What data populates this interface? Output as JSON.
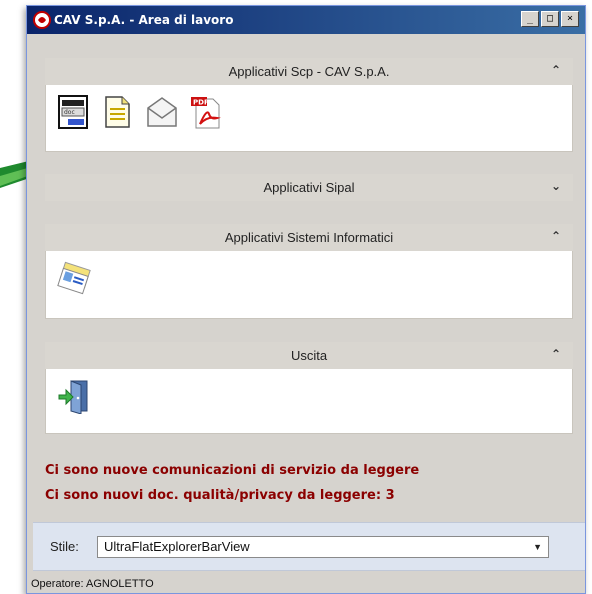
{
  "window": {
    "title": "CAV S.p.A. - Area di lavoro"
  },
  "window_buttons": {
    "minimize": "_",
    "maximize": "□",
    "close": "×"
  },
  "groups": [
    {
      "title": "Applicativi Scp - CAV S.p.A.",
      "chevron": "⌃",
      "expanded": true,
      "icons": [
        "document-scan-icon",
        "text-file-icon",
        "mail-envelope-icon",
        "pdf-icon"
      ]
    },
    {
      "title": "Applicativi Sipal",
      "chevron": "⌄",
      "expanded": false,
      "icons": []
    },
    {
      "title": "Applicativi Sistemi Informatici",
      "chevron": "⌃",
      "expanded": true,
      "icons": [
        "id-card-icon"
      ]
    },
    {
      "title": "Uscita",
      "chevron": "⌃",
      "expanded": true,
      "icons": [
        "exit-door-icon"
      ]
    }
  ],
  "messages": {
    "line1": "Ci sono nuove comunicazioni di servizio da leggere",
    "line2": "Ci sono nuovi doc. qualità/privacy da leggere:  3"
  },
  "style": {
    "label": "Stile:",
    "value": "UltraFlatExplorerBarView"
  },
  "status": {
    "operator": "Operatore: AGNOLETTO"
  },
  "colors": {
    "titlebar": "#0a246a",
    "message": "#8b0000",
    "pointer": "#1f8a2e"
  }
}
